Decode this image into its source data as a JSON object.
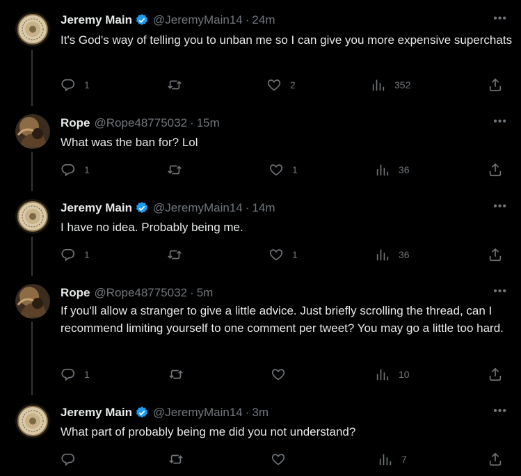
{
  "tweets": [
    {
      "name": "Jeremy Main",
      "verified": true,
      "handle": "@JeremyMain14",
      "time": "24m",
      "text": "It's God's way of telling you to unban me so I can give you more expensive superchats",
      "replies": "1",
      "retweets": "",
      "likes": "2",
      "views": "352",
      "avatar": "seal"
    },
    {
      "name": "Rope",
      "verified": false,
      "handle": "@Rope48775032",
      "time": "15m",
      "text": "What was the ban for? Lol",
      "replies": "1",
      "retweets": "",
      "likes": "1",
      "views": "36",
      "avatar": "photo"
    },
    {
      "name": "Jeremy Main",
      "verified": true,
      "handle": "@JeremyMain14",
      "time": "14m",
      "text": "I have no idea. Probably being me.",
      "replies": "1",
      "retweets": "",
      "likes": "1",
      "views": "36",
      "avatar": "seal"
    },
    {
      "name": "Rope",
      "verified": false,
      "handle": "@Rope48775032",
      "time": "5m",
      "text": "If you'll allow a stranger to give a little advice. Just briefly scrolling the thread, can I recommend limiting yourself to one comment per tweet? You may go a little too hard.",
      "replies": "1",
      "retweets": "",
      "likes": "",
      "views": "10",
      "avatar": "photo"
    },
    {
      "name": "Jeremy Main",
      "verified": true,
      "handle": "@JeremyMain14",
      "time": "3m",
      "text": "What part of probably being me did you not understand?",
      "replies": "",
      "retweets": "",
      "likes": "",
      "views": "7",
      "avatar": "seal"
    }
  ],
  "more_label": "•••",
  "separator": "·",
  "colors": {
    "background": "#000000",
    "text": "#e7e9ea",
    "muted": "#71767b",
    "verified": "#1d9bf0",
    "line": "#333639"
  },
  "icons": [
    "reply-icon",
    "retweet-icon",
    "like-icon",
    "views-icon",
    "share-icon",
    "verified-badge-icon",
    "more-icon"
  ]
}
